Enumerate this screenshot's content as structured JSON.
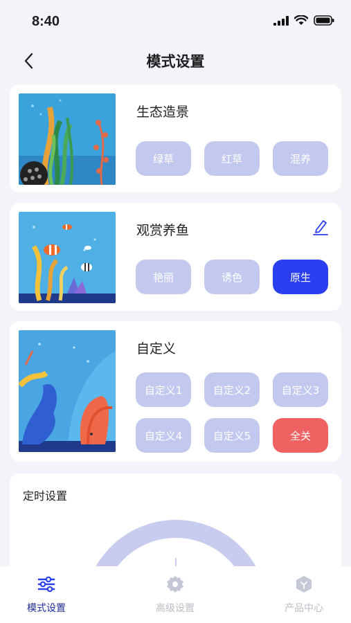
{
  "status": {
    "time": "8:40"
  },
  "nav": {
    "title": "模式设置"
  },
  "cards": [
    {
      "title": "生态造景",
      "chips": [
        "绿草",
        "红草",
        "混养"
      ]
    },
    {
      "title": "观赏养鱼",
      "chips": [
        "艳丽",
        "诱色",
        "原生"
      ],
      "active_chip": "原生"
    },
    {
      "title": "自定义",
      "chips": [
        "自定义1",
        "自定义2",
        "自定义3",
        "自定义4",
        "自定义5",
        "全关"
      ]
    }
  ],
  "timer": {
    "label": "定时设置"
  },
  "tabs": [
    {
      "label": "模式设置",
      "icon": "sliders-icon",
      "active": true
    },
    {
      "label": "高级设置",
      "icon": "gear-icon",
      "active": false
    },
    {
      "label": "产品中心",
      "icon": "hexagon-icon",
      "active": false
    }
  ],
  "colors": {
    "accent": "#2a3ff0",
    "chip": "#c3c8ee",
    "danger": "#f06161",
    "tab_active": "#1d2d9a"
  }
}
